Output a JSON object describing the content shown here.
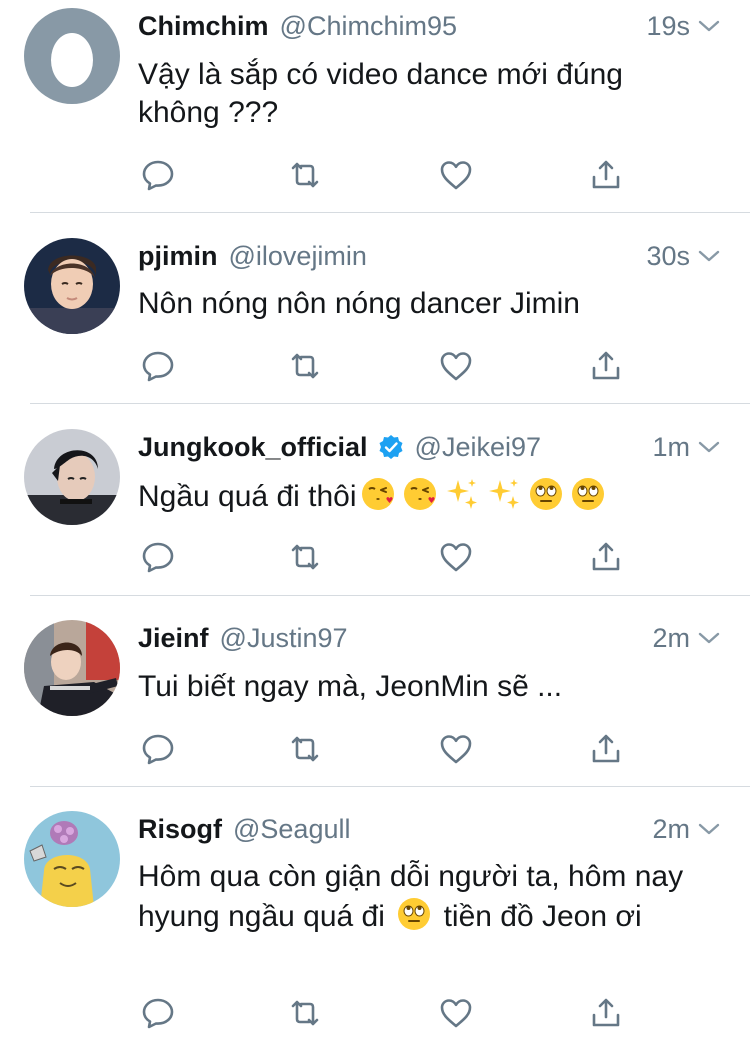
{
  "icons": {
    "reply": "reply-icon",
    "retweet": "retweet-icon",
    "like": "heart-icon",
    "share": "share-icon",
    "caret": "chevron-down-icon",
    "verified": "verified-badge-icon"
  },
  "colors": {
    "text": "#14171a",
    "secondary": "#657786",
    "action": "#657786",
    "verified": "#1da1f2",
    "divider": "#d6dbe0"
  },
  "tweets": [
    {
      "name": "Chimchim",
      "handle": "@Chimchim95",
      "time": "19s",
      "text": "Vậy là sắp có video dance mới đúng không ???"
    },
    {
      "name": "pjimin",
      "handle": "@ilovejimin",
      "time": "30s",
      "text": "Nôn nóng nôn nóng dancer Jimin"
    },
    {
      "name": "Jungkook_official",
      "handle": "@Jeikei97",
      "time": "1m",
      "verified": true,
      "text": "Ngầu quá đi thôi"
    },
    {
      "name": "Jieinf",
      "handle": "@Justin97",
      "time": "2m",
      "text": "Tui biết ngay mà, JeonMin sẽ ..."
    },
    {
      "name": "Risogf",
      "handle": "@Seagull",
      "time": "2m",
      "text_part1": "Hôm qua còn giận dỗi người ta, hôm nay hyung ngầu quá đi",
      "text_part2": "tiền đồ Jeon ơi"
    }
  ]
}
